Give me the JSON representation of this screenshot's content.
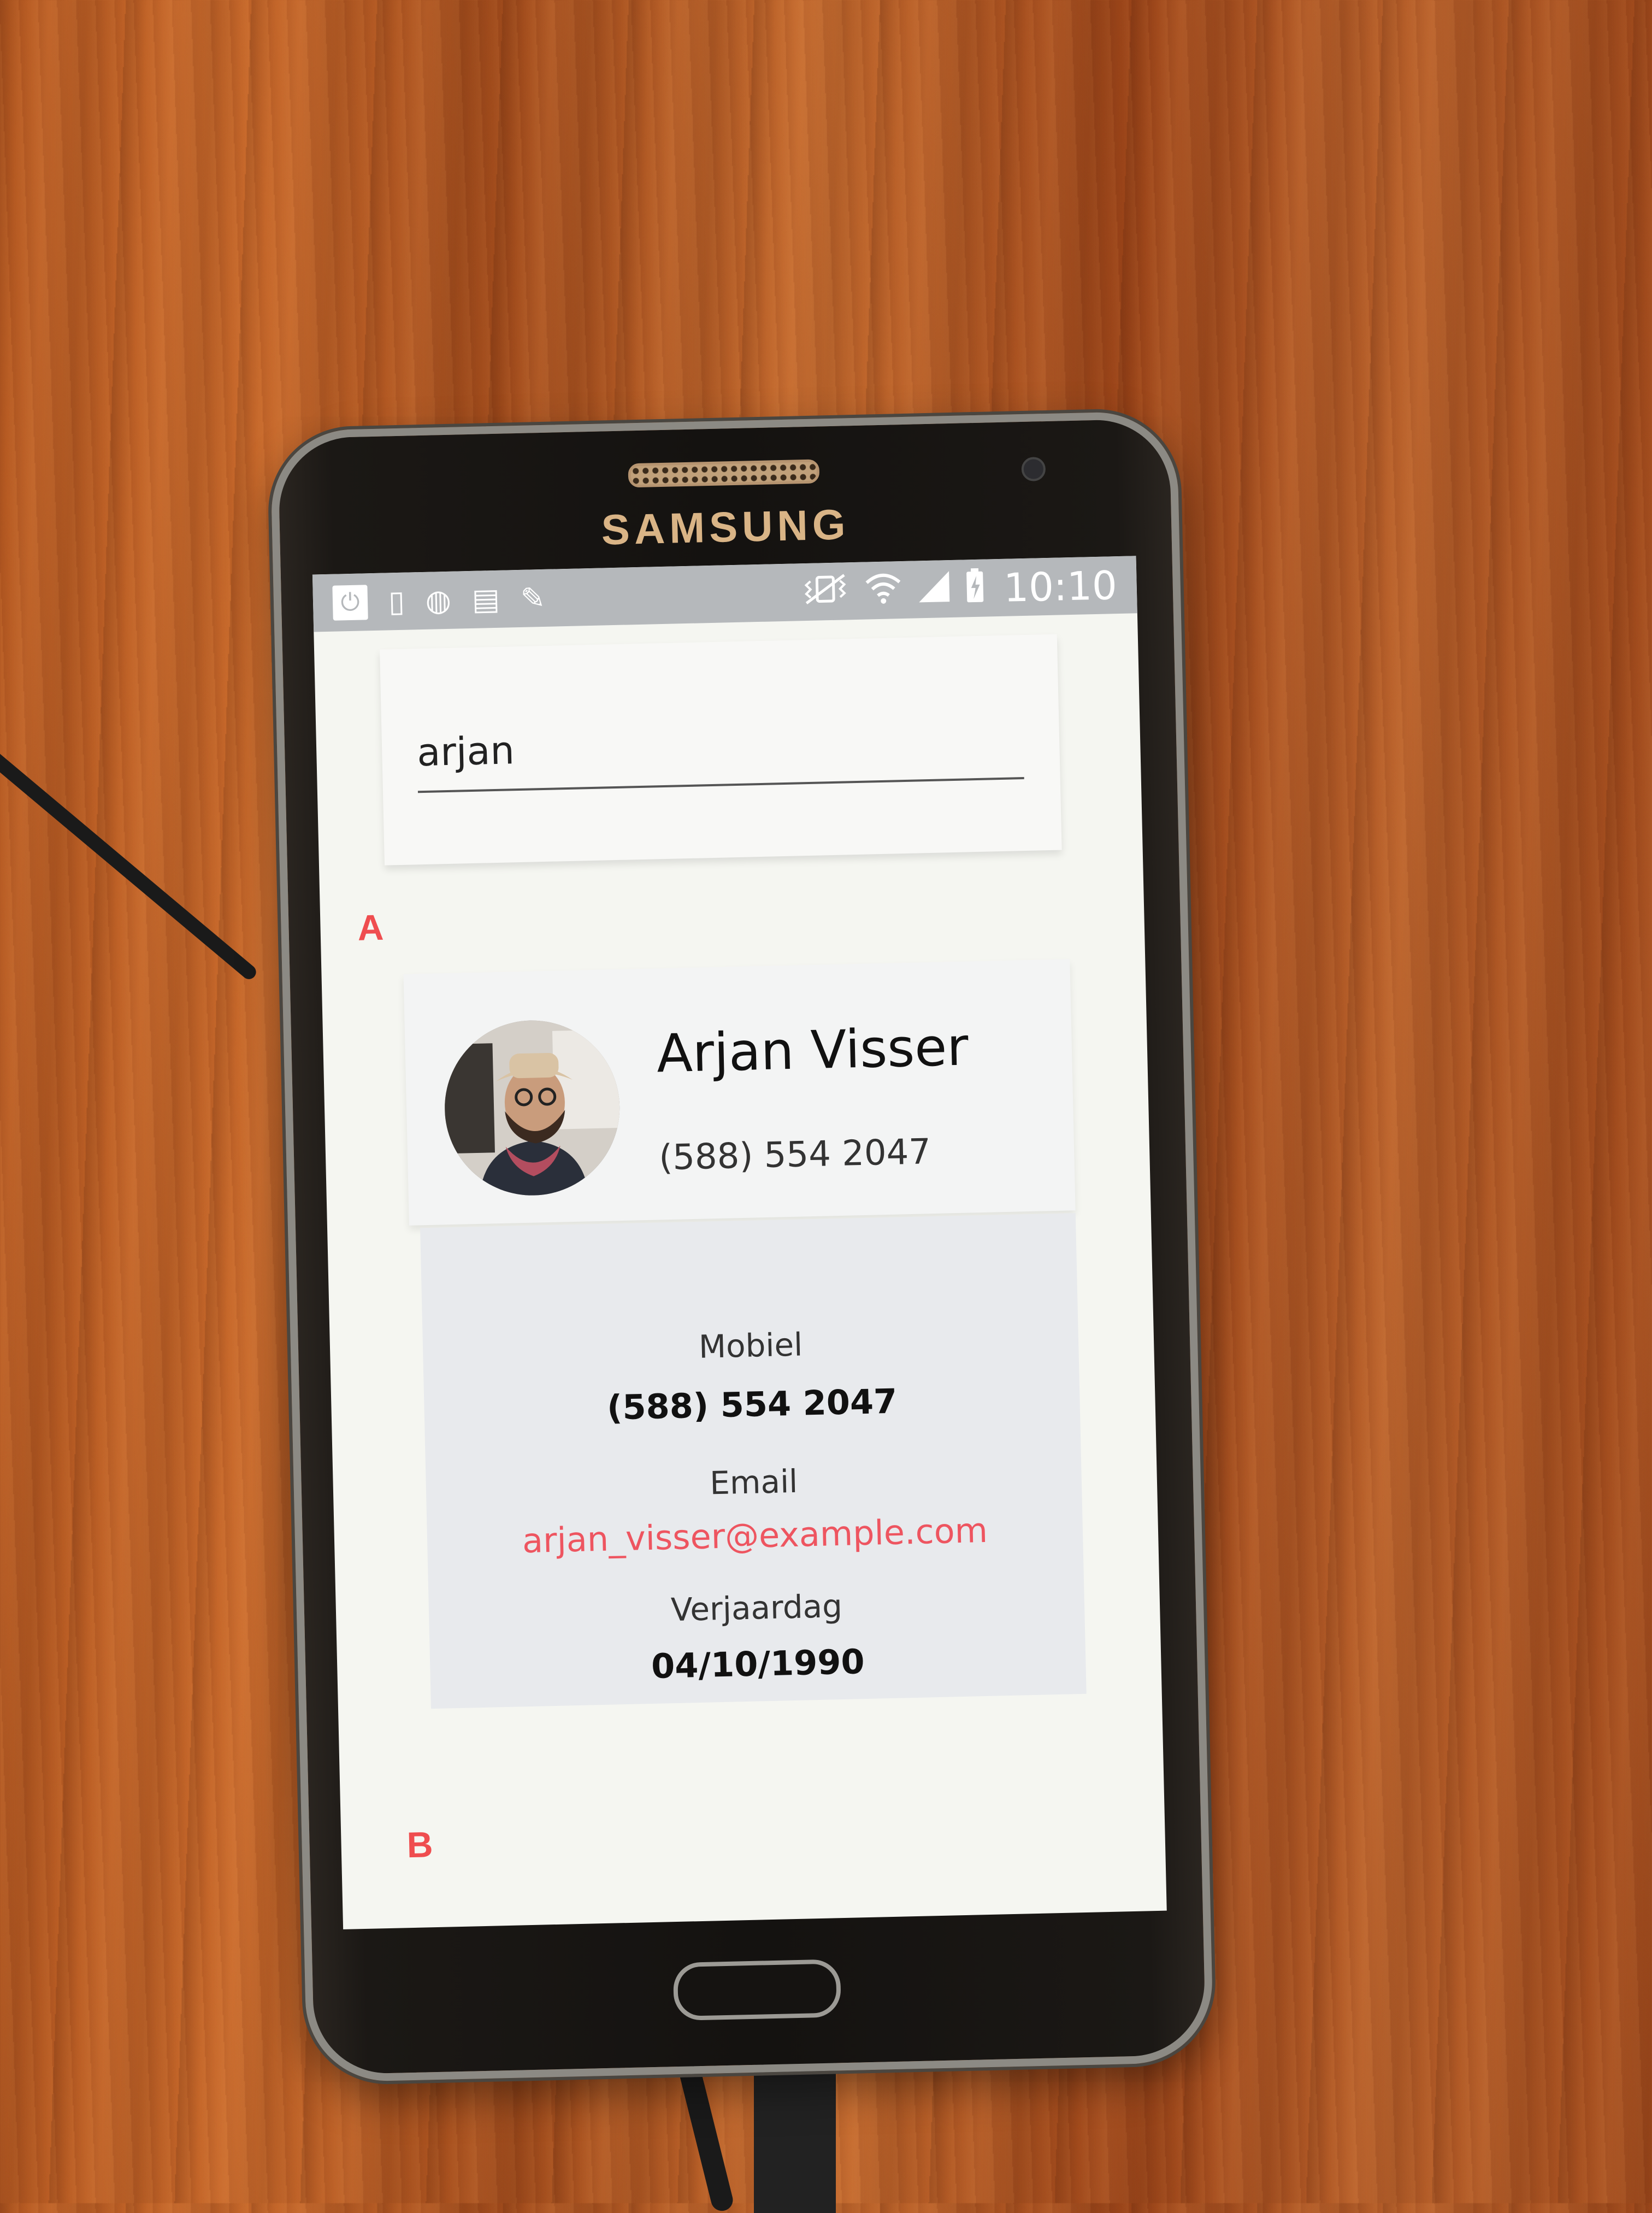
{
  "device": {
    "brand": "SAMSUNG"
  },
  "statusbar": {
    "left_icons": [
      "power-icon",
      "device-check-icon",
      "globe-icon",
      "document-x-icon",
      "pencil-icon"
    ],
    "right_icons": [
      "mute-vibrate-icon",
      "wifi-icon",
      "signal-icon",
      "battery-charging-icon"
    ],
    "time": "10:10"
  },
  "search": {
    "value": "arjan"
  },
  "markers": {
    "a": "A",
    "b": "B"
  },
  "contact": {
    "name": "Arjan Visser",
    "phone": "(588) 554 2047"
  },
  "details": {
    "mobile_label": "Mobiel",
    "mobile_value": "(588) 554 2047",
    "email_label": "Email",
    "email_value": "arjan_visser@example.com",
    "birthday_label": "Verjaardag",
    "birthday_value": "04/10/1990"
  },
  "colors": {
    "accent_email": "#ee5560",
    "marker": "#ef4d4f",
    "statusbar": "#b5b8bb"
  }
}
